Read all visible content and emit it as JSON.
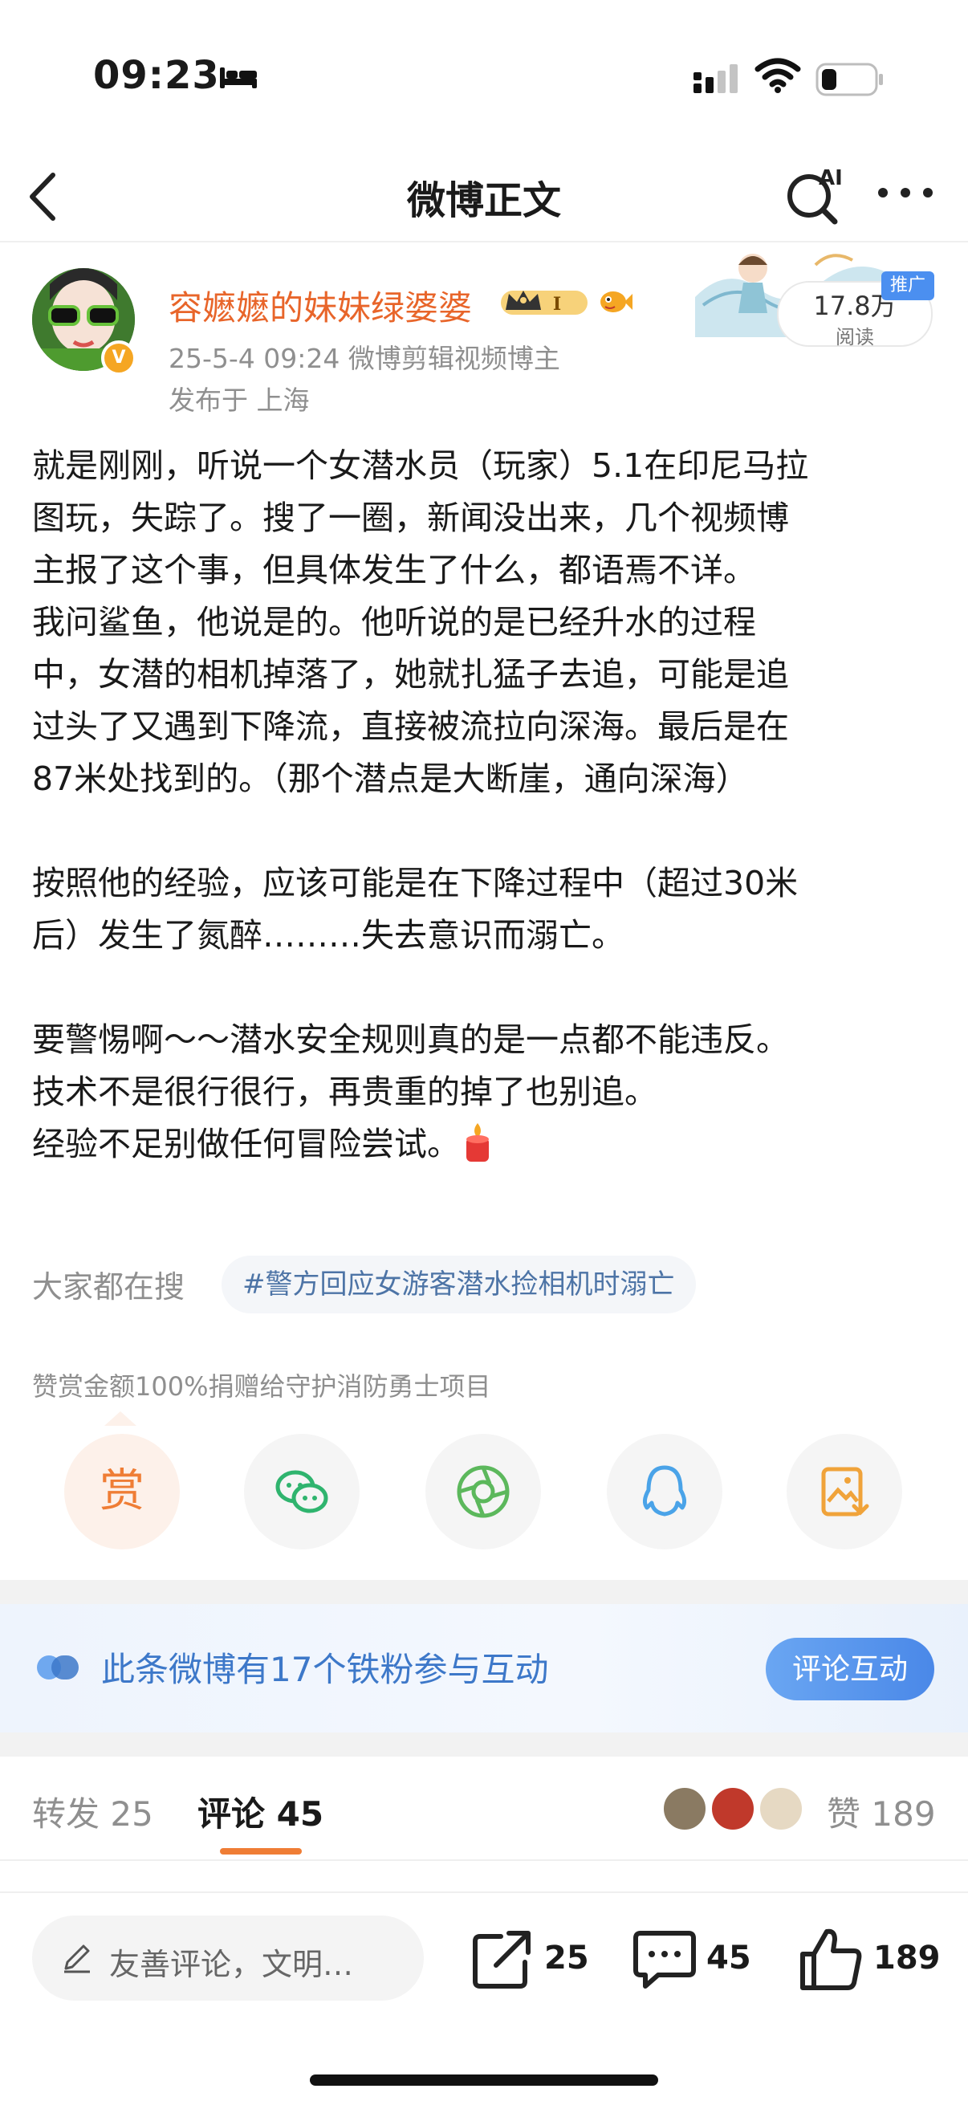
{
  "status": {
    "time": "09:23"
  },
  "nav": {
    "title": "微博正文",
    "ai_label": "AI"
  },
  "author": {
    "name": "容嬷嬷的妹妹绿婆婆",
    "vip_level": "I",
    "verified_mark": "V",
    "meta": "25-5-4 09:24  微博剪辑视频博主",
    "location": "发布于 上海"
  },
  "read": {
    "count": "17.8万",
    "label": "阅读",
    "promo_tag": "推广"
  },
  "post": {
    "lines": [
      "就是刚刚，听说一个女潜水员（玩家）5.1在印尼马拉",
      "图玩，失踪了。搜了一圈，新闻没出来，几个视频博",
      "主报了这个事，但具体发生了什么，都语焉不详。",
      "我问鲨鱼，他说是的。他听说的是已经升水的过程",
      "中，女潜的相机掉落了，她就扎猛子去追，可能是追",
      "过头了又遇到下降流，直接被流拉向深海。最后是在",
      "87米处找到的。（那个潜点是大断崖，通向深海）",
      "按照他的经验，应该可能是在下降过程中（超过30米",
      "后）发生了氮醉………失去意识而溺亡。",
      "要警惕啊～～潜水安全规则真的是一点都不能违反。",
      "技术不是很行很行，再贵重的掉了也别追。",
      "经验不足别做任何冒险尝试。"
    ]
  },
  "search": {
    "label": "大家都在搜",
    "topic": "#警方回应女游客潜水捡相机时溺亡"
  },
  "reward_note": "赞赏金额100%捐赠给守护消防勇士项目",
  "share": {
    "reward_label": "赏"
  },
  "fan_bar": {
    "text": "此条微博有17个铁粉参与互动",
    "button": "评论互动"
  },
  "tabs": {
    "repost_label": "转发",
    "repost_count": "25",
    "comment_label": "评论",
    "comment_count": "45",
    "like_label": "赞",
    "like_count": "189"
  },
  "bottom": {
    "placeholder": "友善评论，文明…",
    "repost_count": "25",
    "comment_count": "45",
    "like_count": "189"
  },
  "colors": {
    "brand_orange": "#ef7d35",
    "link_blue": "#4d74a6",
    "fan_blue": "#3d78c9"
  }
}
